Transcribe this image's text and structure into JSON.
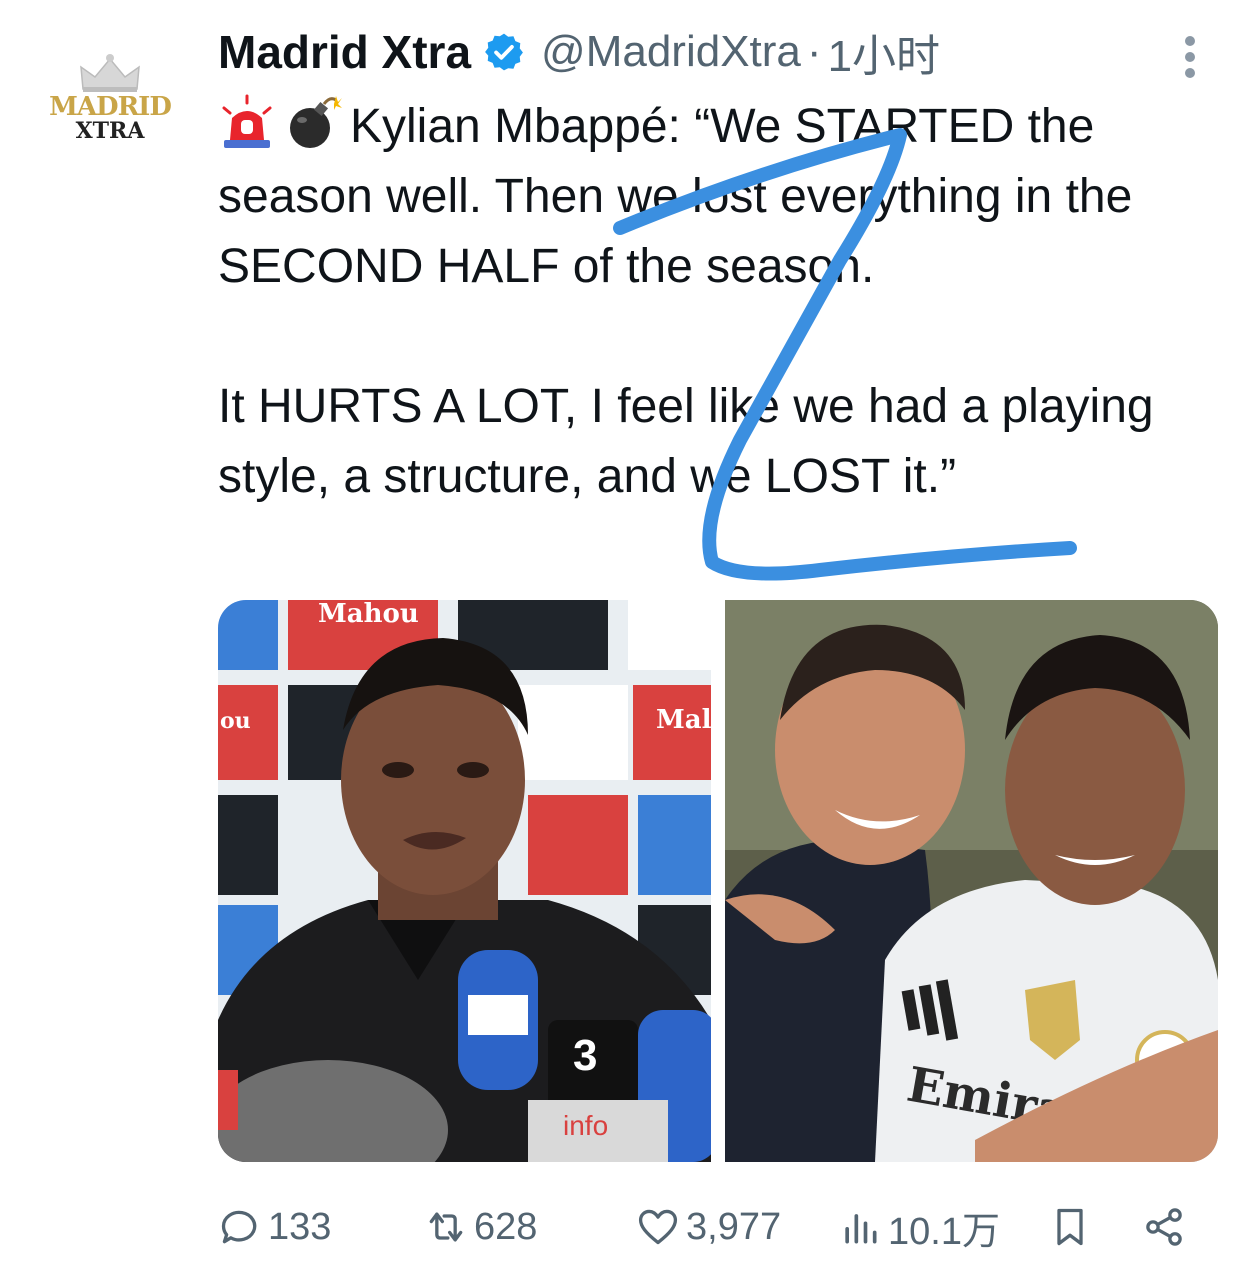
{
  "account": {
    "display_name": "Madrid Xtra",
    "handle": "@MadridXtra",
    "separator": "·",
    "time": "1小时",
    "avatar_text_line1": "MADRID",
    "avatar_text_line2": "XTRA"
  },
  "tweet": {
    "emoji_1": "rotating-light-icon",
    "emoji_2": "bomb-icon",
    "text_part1": "Kylian Mbappé: “We STARTED the season well. Then we lost everything in the SECOND HALF of the season.",
    "text_part2": "It HURTS A LOT, I feel like we had a playing style, a structure, and we LOST it.”"
  },
  "media": {
    "photo_1": {
      "backdrop_brand_1": "Mahou",
      "backdrop_brand_2": "ou",
      "backdrop_brand_3": "Mal",
      "mic_label_1": "3",
      "mic_label_2": "info"
    },
    "photo_2": {
      "shirt_text": "Emira"
    }
  },
  "actions": {
    "replies": "133",
    "reposts": "628",
    "likes": "3,977",
    "views": "10.1万"
  },
  "colors": {
    "verified": "#1d9bf0",
    "secondary_text": "#536471",
    "scribble": "#3b8fe0"
  }
}
